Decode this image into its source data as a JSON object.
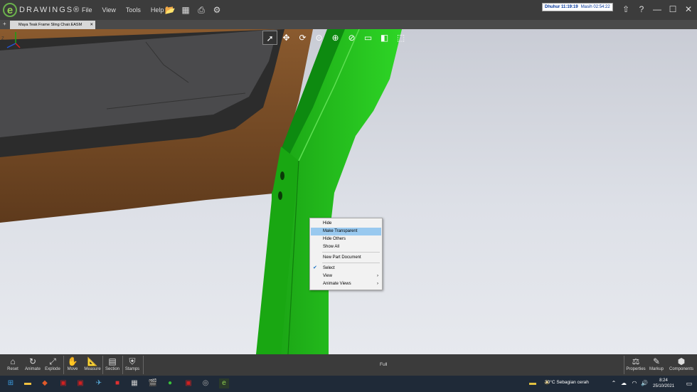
{
  "app": {
    "logo_letter": "e",
    "logo_text": "DRAWINGS®"
  },
  "menu": [
    "File",
    "View",
    "Tools",
    "Help"
  ],
  "toolbar_icons": [
    "open-icon",
    "save-icon",
    "print-icon",
    "settings-icon"
  ],
  "timer": {
    "label": "Dhuhur 11:19:19",
    "remaining": "Masih 02:54:22"
  },
  "window_icons": [
    "upload-icon",
    "help-icon",
    "minimize-icon",
    "maximize-icon",
    "close-icon"
  ],
  "tab": {
    "title": "Maya Teak Frame Sling Chair.EASM",
    "close": "✕",
    "plus": "+"
  },
  "view_tools": [
    "select-icon",
    "pan-icon",
    "rotate-icon",
    "zoom-fit-icon",
    "zoom-area-icon",
    "zoom-icon",
    "display-icon",
    "style-icon",
    "view-cube-icon"
  ],
  "context_menu": {
    "items": [
      "Hide",
      "Make Transparent",
      "Hide Others",
      "Show All",
      "New Part Document",
      "Select",
      "View",
      "Animate Views"
    ],
    "highlighted": "Make Transparent",
    "checked": "Select",
    "submenu_arrow": "›"
  },
  "triad": {
    "x": "X",
    "y": "Y",
    "z": "Z"
  },
  "bottom_left": [
    {
      "label": "Reset",
      "icon": "home-icon"
    },
    {
      "label": "Animate",
      "icon": "animate-icon"
    },
    {
      "label": "Explode",
      "icon": "explode-icon"
    },
    {
      "label": "Move",
      "icon": "move-icon"
    },
    {
      "label": "Measure",
      "icon": "measure-icon"
    },
    {
      "label": "Section",
      "icon": "section-icon"
    },
    {
      "label": "Stamps",
      "icon": "stamps-icon"
    }
  ],
  "bottom_center": "Full",
  "bottom_right": [
    {
      "label": "Properties",
      "icon": "properties-icon"
    },
    {
      "label": "Markup",
      "icon": "markup-icon"
    },
    {
      "label": "Components",
      "icon": "components-icon"
    }
  ],
  "taskbar": {
    "weather": "30°C  Sebagian cerah",
    "time": "8:24",
    "date": "25/10/2021"
  },
  "colors": {
    "accent_green": "#22c41a",
    "wood": "#7a4a25",
    "highlight": "#99c9ef"
  }
}
